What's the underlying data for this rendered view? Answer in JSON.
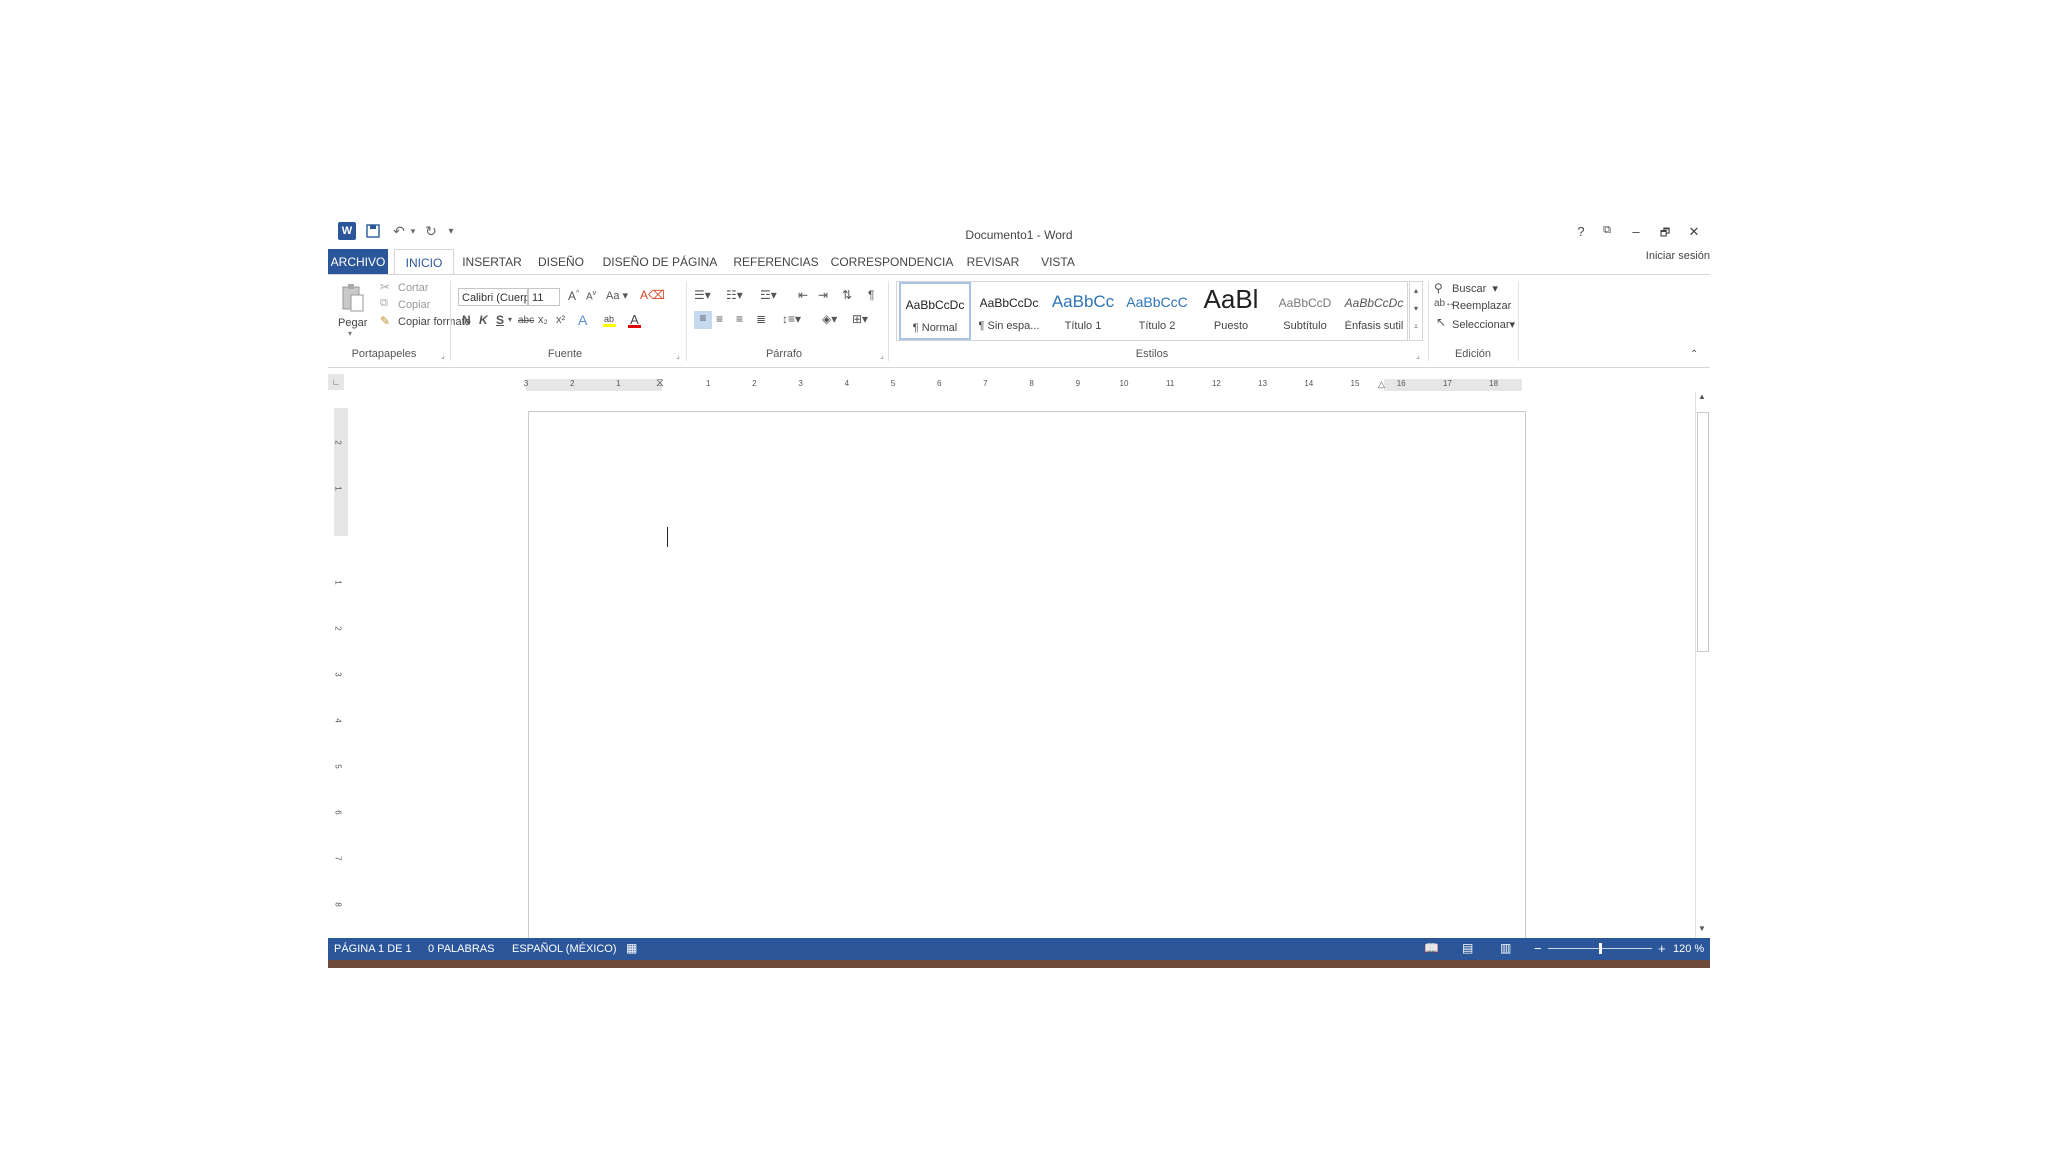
{
  "window": {
    "title": "Documento1 - Word",
    "help": "?",
    "minimize": "–",
    "restore": "🗗",
    "close": "✕",
    "ribbon_options": "⧉"
  },
  "qat": {
    "word_icon": "W",
    "save_icon": "💾",
    "undo_icon": "↶",
    "undo_dropdown": "▾",
    "redo_icon": "↻",
    "customize_icon": "▾"
  },
  "tabs": [
    {
      "label": "ARCHIVO"
    },
    {
      "label": "INICIO"
    },
    {
      "label": "INSERTAR"
    },
    {
      "label": "DISEÑO"
    },
    {
      "label": "DISEÑO DE PÁGINA"
    },
    {
      "label": "REFERENCIAS"
    },
    {
      "label": "CORRESPONDENCIA"
    },
    {
      "label": "REVISAR"
    },
    {
      "label": "VISTA"
    }
  ],
  "signin": "Iniciar sesión",
  "clipboard": {
    "paste": "Pegar",
    "cut": "Cortar",
    "copy": "Copiar",
    "format_painter": "Copiar formato",
    "group": "Portapapeles"
  },
  "font": {
    "name": "Calibri (Cuerpo",
    "size": "11",
    "grow": "A",
    "shrink": "A",
    "case": "Aa",
    "bold": "N",
    "italic": "K",
    "underline": "S",
    "strike": "abc",
    "subscript": "x₂",
    "superscript": "x²",
    "effects": "A",
    "font_color": "A",
    "group": "Fuente"
  },
  "paragraph": {
    "pilcrow": "¶",
    "group": "Párrafo"
  },
  "styles": {
    "items": [
      {
        "preview": "AaBbCcDc",
        "name": "¶ Normal"
      },
      {
        "preview": "AaBbCcDc",
        "name": "¶ Sin espa..."
      },
      {
        "preview": "AaBbCc",
        "name": "Título 1"
      },
      {
        "preview": "AaBbCcC",
        "name": "Título 2"
      },
      {
        "preview": "AaBl",
        "name": "Puesto"
      },
      {
        "preview": "AaBbCcD",
        "name": "Subtítulo"
      },
      {
        "preview": "AaBbCcDc",
        "name": "Énfasis sutil"
      }
    ],
    "group": "Estilos"
  },
  "editing": {
    "find": "Buscar",
    "replace": "Reemplazar",
    "select": "Seleccionar",
    "group": "Edición"
  },
  "ruler": {
    "h_numbers": [
      "3",
      "2",
      "1",
      "1",
      "2",
      "3",
      "4",
      "5",
      "6",
      "7",
      "8",
      "9",
      "10",
      "11",
      "12",
      "13",
      "14",
      "15",
      "16",
      "17",
      "18"
    ],
    "v_numbers": [
      "2",
      "1",
      "1",
      "2",
      "3",
      "4",
      "5",
      "6",
      "7",
      "8"
    ]
  },
  "status": {
    "page": "PÁGINA 1 DE 1",
    "words": "0 PALABRAS",
    "language": "ESPAÑOL (MÉXICO)",
    "zoom": "120 %",
    "zoom_minus": "−",
    "zoom_plus": "+",
    "zoom_level": 0.5
  },
  "colors": {
    "accent": "#2b579a",
    "ruler_gray": "#e6e6e6"
  }
}
